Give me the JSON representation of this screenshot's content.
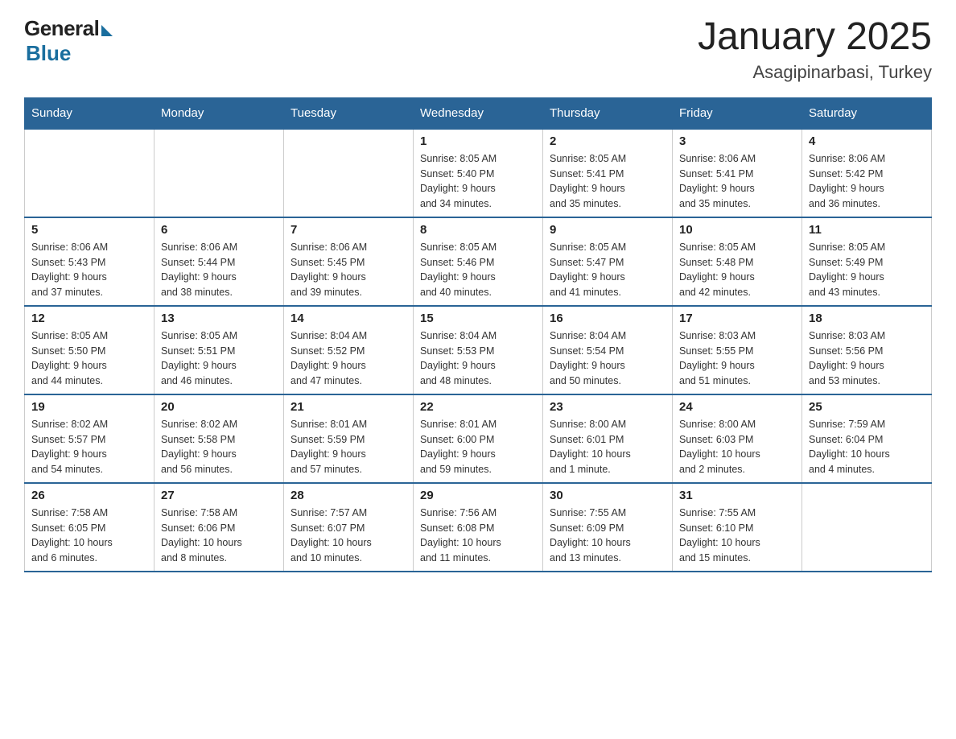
{
  "logo": {
    "general": "General",
    "blue": "Blue",
    "subtitle": "Blue"
  },
  "header": {
    "month_title": "January 2025",
    "location": "Asagipinarbasi, Turkey"
  },
  "weekdays": [
    "Sunday",
    "Monday",
    "Tuesday",
    "Wednesday",
    "Thursday",
    "Friday",
    "Saturday"
  ],
  "weeks": [
    [
      {
        "day": "",
        "info": ""
      },
      {
        "day": "",
        "info": ""
      },
      {
        "day": "",
        "info": ""
      },
      {
        "day": "1",
        "info": "Sunrise: 8:05 AM\nSunset: 5:40 PM\nDaylight: 9 hours\nand 34 minutes."
      },
      {
        "day": "2",
        "info": "Sunrise: 8:05 AM\nSunset: 5:41 PM\nDaylight: 9 hours\nand 35 minutes."
      },
      {
        "day": "3",
        "info": "Sunrise: 8:06 AM\nSunset: 5:41 PM\nDaylight: 9 hours\nand 35 minutes."
      },
      {
        "day": "4",
        "info": "Sunrise: 8:06 AM\nSunset: 5:42 PM\nDaylight: 9 hours\nand 36 minutes."
      }
    ],
    [
      {
        "day": "5",
        "info": "Sunrise: 8:06 AM\nSunset: 5:43 PM\nDaylight: 9 hours\nand 37 minutes."
      },
      {
        "day": "6",
        "info": "Sunrise: 8:06 AM\nSunset: 5:44 PM\nDaylight: 9 hours\nand 38 minutes."
      },
      {
        "day": "7",
        "info": "Sunrise: 8:06 AM\nSunset: 5:45 PM\nDaylight: 9 hours\nand 39 minutes."
      },
      {
        "day": "8",
        "info": "Sunrise: 8:05 AM\nSunset: 5:46 PM\nDaylight: 9 hours\nand 40 minutes."
      },
      {
        "day": "9",
        "info": "Sunrise: 8:05 AM\nSunset: 5:47 PM\nDaylight: 9 hours\nand 41 minutes."
      },
      {
        "day": "10",
        "info": "Sunrise: 8:05 AM\nSunset: 5:48 PM\nDaylight: 9 hours\nand 42 minutes."
      },
      {
        "day": "11",
        "info": "Sunrise: 8:05 AM\nSunset: 5:49 PM\nDaylight: 9 hours\nand 43 minutes."
      }
    ],
    [
      {
        "day": "12",
        "info": "Sunrise: 8:05 AM\nSunset: 5:50 PM\nDaylight: 9 hours\nand 44 minutes."
      },
      {
        "day": "13",
        "info": "Sunrise: 8:05 AM\nSunset: 5:51 PM\nDaylight: 9 hours\nand 46 minutes."
      },
      {
        "day": "14",
        "info": "Sunrise: 8:04 AM\nSunset: 5:52 PM\nDaylight: 9 hours\nand 47 minutes."
      },
      {
        "day": "15",
        "info": "Sunrise: 8:04 AM\nSunset: 5:53 PM\nDaylight: 9 hours\nand 48 minutes."
      },
      {
        "day": "16",
        "info": "Sunrise: 8:04 AM\nSunset: 5:54 PM\nDaylight: 9 hours\nand 50 minutes."
      },
      {
        "day": "17",
        "info": "Sunrise: 8:03 AM\nSunset: 5:55 PM\nDaylight: 9 hours\nand 51 minutes."
      },
      {
        "day": "18",
        "info": "Sunrise: 8:03 AM\nSunset: 5:56 PM\nDaylight: 9 hours\nand 53 minutes."
      }
    ],
    [
      {
        "day": "19",
        "info": "Sunrise: 8:02 AM\nSunset: 5:57 PM\nDaylight: 9 hours\nand 54 minutes."
      },
      {
        "day": "20",
        "info": "Sunrise: 8:02 AM\nSunset: 5:58 PM\nDaylight: 9 hours\nand 56 minutes."
      },
      {
        "day": "21",
        "info": "Sunrise: 8:01 AM\nSunset: 5:59 PM\nDaylight: 9 hours\nand 57 minutes."
      },
      {
        "day": "22",
        "info": "Sunrise: 8:01 AM\nSunset: 6:00 PM\nDaylight: 9 hours\nand 59 minutes."
      },
      {
        "day": "23",
        "info": "Sunrise: 8:00 AM\nSunset: 6:01 PM\nDaylight: 10 hours\nand 1 minute."
      },
      {
        "day": "24",
        "info": "Sunrise: 8:00 AM\nSunset: 6:03 PM\nDaylight: 10 hours\nand 2 minutes."
      },
      {
        "day": "25",
        "info": "Sunrise: 7:59 AM\nSunset: 6:04 PM\nDaylight: 10 hours\nand 4 minutes."
      }
    ],
    [
      {
        "day": "26",
        "info": "Sunrise: 7:58 AM\nSunset: 6:05 PM\nDaylight: 10 hours\nand 6 minutes."
      },
      {
        "day": "27",
        "info": "Sunrise: 7:58 AM\nSunset: 6:06 PM\nDaylight: 10 hours\nand 8 minutes."
      },
      {
        "day": "28",
        "info": "Sunrise: 7:57 AM\nSunset: 6:07 PM\nDaylight: 10 hours\nand 10 minutes."
      },
      {
        "day": "29",
        "info": "Sunrise: 7:56 AM\nSunset: 6:08 PM\nDaylight: 10 hours\nand 11 minutes."
      },
      {
        "day": "30",
        "info": "Sunrise: 7:55 AM\nSunset: 6:09 PM\nDaylight: 10 hours\nand 13 minutes."
      },
      {
        "day": "31",
        "info": "Sunrise: 7:55 AM\nSunset: 6:10 PM\nDaylight: 10 hours\nand 15 minutes."
      },
      {
        "day": "",
        "info": ""
      }
    ]
  ]
}
